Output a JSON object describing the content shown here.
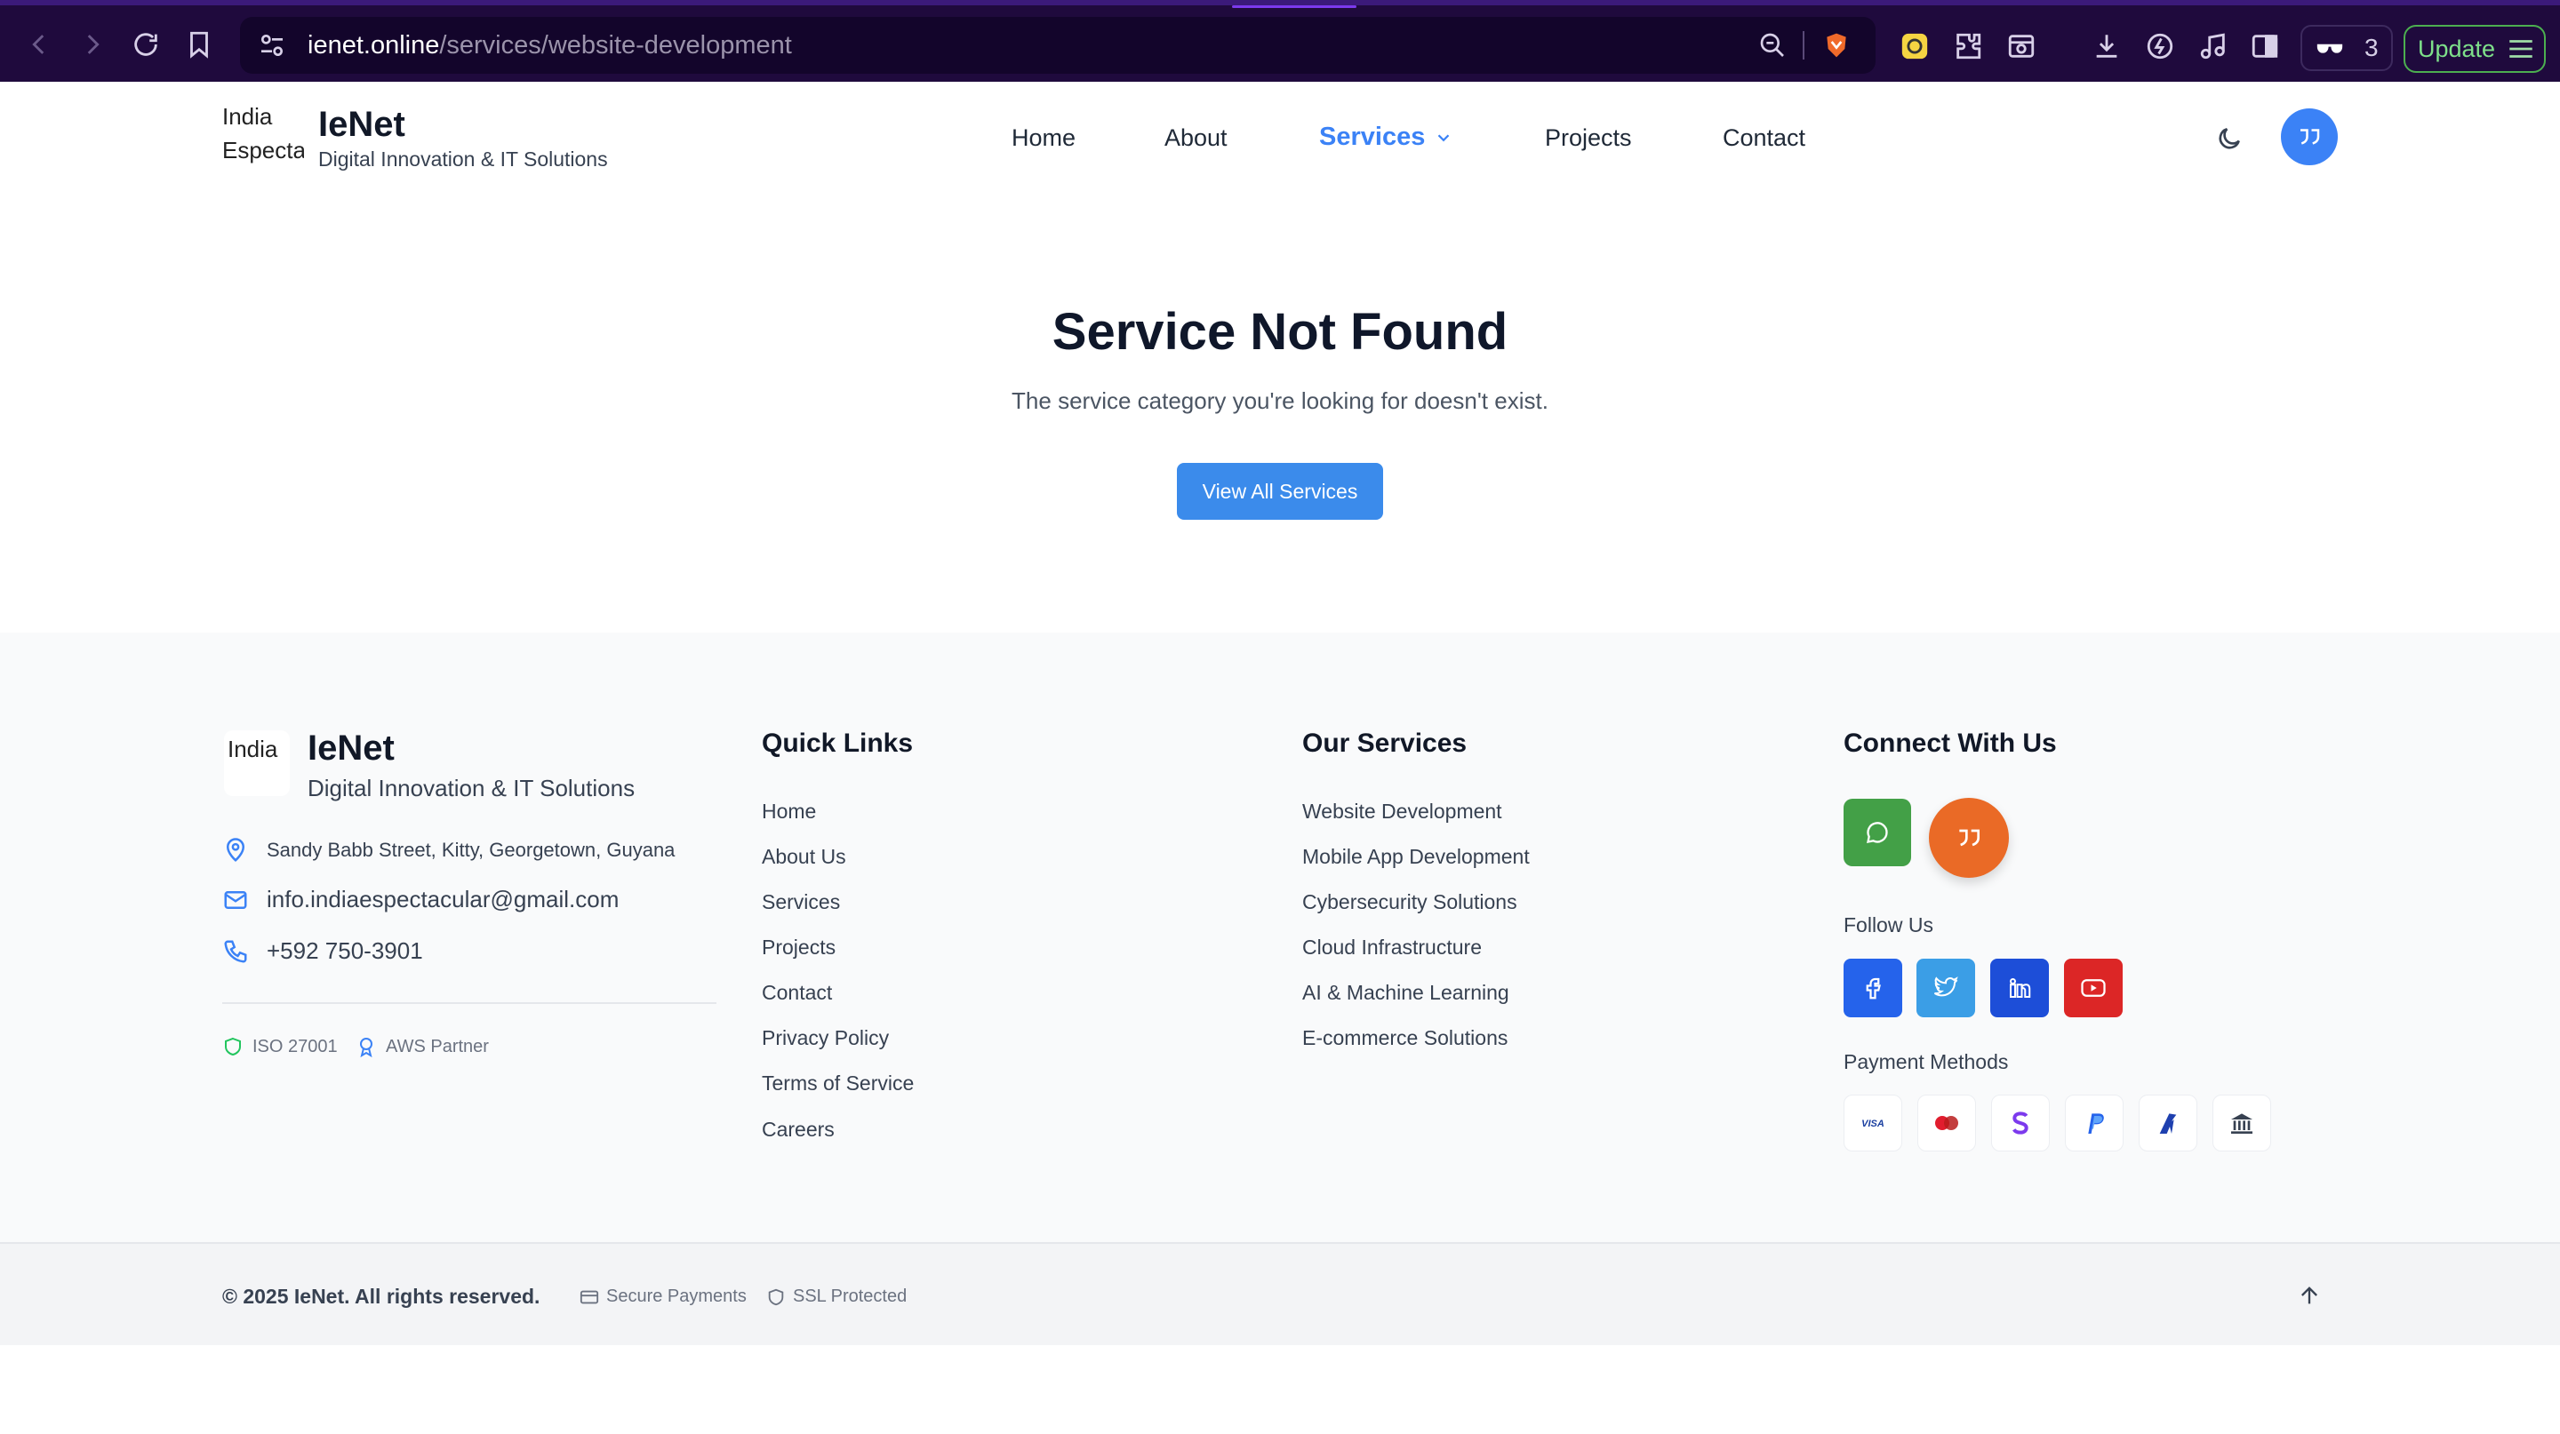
{
  "browser": {
    "url_domain": "ienet.online",
    "url_path": "/services/website-development",
    "tab_count": "3",
    "update_label": "Update",
    "icons": [
      "back-icon",
      "forward-icon",
      "reload-icon",
      "bookmark-icon",
      "site-settings-icon",
      "zoom-icon",
      "brave-shield-icon",
      "extension-icon",
      "puzzle-icon",
      "screenshot-icon",
      "download-icon",
      "leo-icon",
      "music-icon",
      "sidebar-icon",
      "private-icon",
      "menu-icon"
    ]
  },
  "header": {
    "logo_alt": "India Espectacular",
    "brand": "IeNet",
    "tagline": "Digital Innovation & IT Solutions",
    "nav": [
      "Home",
      "About",
      "Services",
      "Projects",
      "Contact"
    ],
    "active_nav": "Services"
  },
  "main": {
    "title": "Service Not Found",
    "subtitle": "The service category you're looking for doesn't exist.",
    "cta": "View All Services"
  },
  "footer": {
    "logo_alt": "India",
    "brand": "IeNet",
    "tagline": "Digital Innovation & IT Solutions",
    "address": "Sandy Babb Street, Kitty, Georgetown, Guyana",
    "email": "info.indiaespectacular@gmail.com",
    "phone": "+592 750-3901",
    "certs": [
      "ISO 27001",
      "AWS Partner"
    ],
    "quick_links_title": "Quick Links",
    "quick_links": [
      "Home",
      "About Us",
      "Services",
      "Projects",
      "Contact",
      "Privacy Policy",
      "Terms of Service",
      "Careers"
    ],
    "services_title": "Our Services",
    "services": [
      "Website Development",
      "Mobile App Development",
      "Cybersecurity Solutions",
      "Cloud Infrastructure",
      "AI & Machine Learning",
      "E-commerce Solutions"
    ],
    "connect_title": "Connect With Us",
    "follow_label": "Follow Us",
    "payment_label": "Payment Methods",
    "social": [
      "facebook",
      "twitter",
      "linkedin",
      "youtube"
    ],
    "social_colors": {
      "facebook": "#2563eb",
      "twitter": "#3b9ee6",
      "linkedin": "#1d4ed8",
      "youtube": "#dc2626"
    },
    "payments": [
      "visa",
      "mastercard",
      "skrill",
      "paypal",
      "razorpay",
      "bank"
    ]
  },
  "bottom": {
    "copyright": "© 2025 IeNet. All rights reserved.",
    "secure": "Secure Payments",
    "ssl": "SSL Protected"
  }
}
